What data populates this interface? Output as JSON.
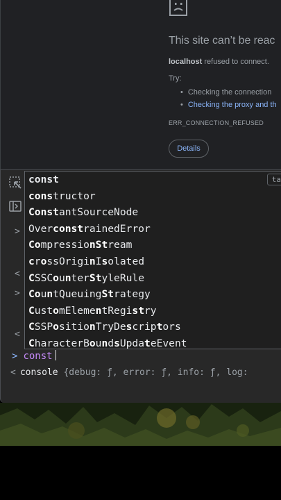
{
  "error_page": {
    "title": "This site can’t be reac",
    "host": "localhost",
    "description": " refused to connect.",
    "try_label": "Try:",
    "suggestions": [
      "Checking the connection",
      "Checking the proxy and th"
    ],
    "error_code": "ERR_CONNECTION_REFUSED",
    "details_label": "Details"
  },
  "console": {
    "prompt_caret": ">",
    "input_value": "const",
    "result_caret": "<",
    "result_object": "console",
    "result_preview": "{debug: ƒ, error: ƒ, info: ƒ, log:",
    "side_chevrons": [
      ">",
      "<",
      ">",
      "<"
    ]
  },
  "autocomplete": {
    "tab_hint": "ta",
    "items": [
      "const",
      "constructor",
      "ConstantSourceNode",
      "OverconstrainedError",
      "CompressionStream",
      "crossOriginIsolated",
      "CSSCounterStyleRule",
      "CountQueuingStrategy",
      "CustomElementRegistry",
      "CSSPositionTryDescriptors",
      "CharacterBoundsUpdateEvent"
    ]
  },
  "colors": {
    "link": "#8ab4f8",
    "keyword": "#c58af9",
    "panel_bg": "#282828"
  }
}
